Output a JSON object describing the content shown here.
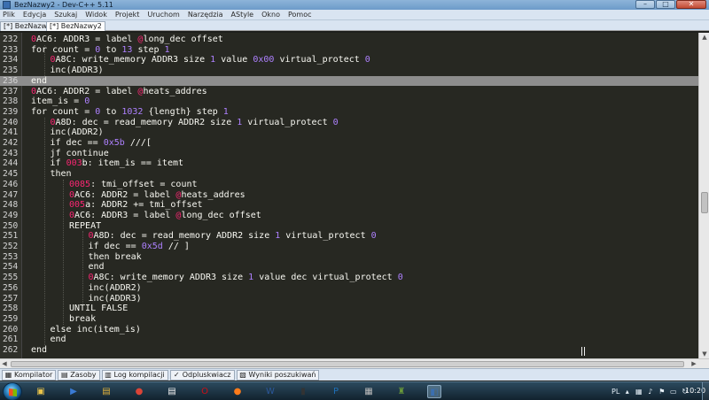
{
  "window": {
    "title": "BezNazwy2 - Dev-C++ 5.11"
  },
  "menu": [
    "Plik",
    "Edycja",
    "Szukaj",
    "Widok",
    "Projekt",
    "Uruchom",
    "Narzędzia",
    "AStyle",
    "Okno",
    "Pomoc"
  ],
  "tabs": [
    "[*] BezNazwy1",
    "[*] BezNazwy2"
  ],
  "active_tab_index": 1,
  "highlighted_line": 236,
  "colors": {
    "label_prefix": "#f92672",
    "number": "#ae81ff",
    "text": "#f8f8f2",
    "background": "#272822",
    "current_line": "#8d8d8d"
  },
  "lines": [
    {
      "n": "232",
      "indent": 1,
      "tokens": [
        [
          "lab",
          "0"
        ],
        [
          "txt",
          "AC6: ADDR3 = label "
        ],
        [
          "lab",
          "@"
        ],
        [
          "txt",
          "long_dec offset"
        ]
      ]
    },
    {
      "n": "233",
      "indent": 1,
      "tokens": [
        [
          "txt",
          "for count = "
        ],
        [
          "num",
          "0"
        ],
        [
          "txt",
          " to "
        ],
        [
          "num",
          "13"
        ],
        [
          "txt",
          " step "
        ],
        [
          "num",
          "1"
        ]
      ]
    },
    {
      "n": "234",
      "indent": 2,
      "tokens": [
        [
          "lab",
          "0"
        ],
        [
          "txt",
          "A8C: write_memory ADDR3 size "
        ],
        [
          "num",
          "1"
        ],
        [
          "txt",
          " value "
        ],
        [
          "num",
          "0x00"
        ],
        [
          "txt",
          " virtual_protect "
        ],
        [
          "num",
          "0"
        ]
      ]
    },
    {
      "n": "235",
      "indent": 2,
      "tokens": [
        [
          "txt",
          "inc(ADDR3)"
        ]
      ]
    },
    {
      "n": "236",
      "indent": 1,
      "tokens": [
        [
          "txt",
          "end"
        ]
      ]
    },
    {
      "n": "237",
      "indent": 1,
      "tokens": [
        [
          "lab",
          "0"
        ],
        [
          "txt",
          "AC6: ADDR2 = label "
        ],
        [
          "lab",
          "@"
        ],
        [
          "txt",
          "heats_addres"
        ]
      ]
    },
    {
      "n": "238",
      "indent": 1,
      "tokens": [
        [
          "txt",
          "item_is = "
        ],
        [
          "num",
          "0"
        ]
      ]
    },
    {
      "n": "239",
      "indent": 1,
      "tokens": [
        [
          "txt",
          "for count = "
        ],
        [
          "num",
          "0"
        ],
        [
          "txt",
          " to "
        ],
        [
          "num",
          "1032"
        ],
        [
          "txt",
          " {length} step "
        ],
        [
          "num",
          "1"
        ]
      ]
    },
    {
      "n": "240",
      "indent": 2,
      "tokens": [
        [
          "lab",
          "0"
        ],
        [
          "txt",
          "A8D: dec = read_memory ADDR2 size "
        ],
        [
          "num",
          "1"
        ],
        [
          "txt",
          " virtual_protect "
        ],
        [
          "num",
          "0"
        ]
      ]
    },
    {
      "n": "241",
      "indent": 2,
      "tokens": [
        [
          "txt",
          "inc(ADDR2)"
        ]
      ]
    },
    {
      "n": "242",
      "indent": 2,
      "tokens": [
        [
          "txt",
          "if dec == "
        ],
        [
          "num",
          "0x5b"
        ],
        [
          "txt",
          " ///["
        ]
      ]
    },
    {
      "n": "243",
      "indent": 2,
      "tokens": [
        [
          "txt",
          "jf continue"
        ]
      ]
    },
    {
      "n": "244",
      "indent": 2,
      "tokens": [
        [
          "txt",
          "if "
        ],
        [
          "lab",
          "003"
        ],
        [
          "txt",
          "b: item_is == itemt"
        ]
      ]
    },
    {
      "n": "245",
      "indent": 2,
      "tokens": [
        [
          "txt",
          "then"
        ]
      ]
    },
    {
      "n": "246",
      "indent": 3,
      "tokens": [
        [
          "lab",
          "0085"
        ],
        [
          "txt",
          ": tmi_offset = count"
        ]
      ]
    },
    {
      "n": "247",
      "indent": 3,
      "tokens": [
        [
          "lab",
          "0"
        ],
        [
          "txt",
          "AC6: ADDR2 = label "
        ],
        [
          "lab",
          "@"
        ],
        [
          "txt",
          "heats_addres"
        ]
      ]
    },
    {
      "n": "248",
      "indent": 3,
      "tokens": [
        [
          "lab",
          "005"
        ],
        [
          "txt",
          "a: ADDR2 += tmi_offset"
        ]
      ]
    },
    {
      "n": "249",
      "indent": 3,
      "tokens": [
        [
          "lab",
          "0"
        ],
        [
          "txt",
          "AC6: ADDR3 = label "
        ],
        [
          "lab",
          "@"
        ],
        [
          "txt",
          "long_dec offset"
        ]
      ]
    },
    {
      "n": "250",
      "indent": 3,
      "tokens": [
        [
          "txt",
          "REPEAT"
        ]
      ]
    },
    {
      "n": "251",
      "indent": 4,
      "tokens": [
        [
          "lab",
          "0"
        ],
        [
          "txt",
          "A8D: dec = read_memory ADDR2 size "
        ],
        [
          "num",
          "1"
        ],
        [
          "txt",
          " virtual_protect "
        ],
        [
          "num",
          "0"
        ]
      ]
    },
    {
      "n": "252",
      "indent": 4,
      "tokens": [
        [
          "txt",
          "if dec == "
        ],
        [
          "num",
          "0x5d"
        ],
        [
          "txt",
          " // ]"
        ]
      ]
    },
    {
      "n": "253",
      "indent": 4,
      "tokens": [
        [
          "txt",
          "then break"
        ]
      ]
    },
    {
      "n": "254",
      "indent": 4,
      "tokens": [
        [
          "txt",
          "end"
        ]
      ]
    },
    {
      "n": "255",
      "indent": 4,
      "tokens": [
        [
          "lab",
          "0"
        ],
        [
          "txt",
          "A8C: write_memory ADDR3 size "
        ],
        [
          "num",
          "1"
        ],
        [
          "txt",
          " value dec virtual_protect "
        ],
        [
          "num",
          "0"
        ]
      ]
    },
    {
      "n": "256",
      "indent": 4,
      "tokens": [
        [
          "txt",
          "inc(ADDR2)"
        ]
      ]
    },
    {
      "n": "257",
      "indent": 4,
      "tokens": [
        [
          "txt",
          "inc(ADDR3)"
        ]
      ]
    },
    {
      "n": "258",
      "indent": 3,
      "tokens": [
        [
          "txt",
          "UNTIL FALSE"
        ]
      ]
    },
    {
      "n": "259",
      "indent": 3,
      "tokens": [
        [
          "txt",
          "break"
        ]
      ]
    },
    {
      "n": "260",
      "indent": 2,
      "tokens": [
        [
          "txt",
          "else inc(item_is)"
        ]
      ]
    },
    {
      "n": "261",
      "indent": 2,
      "tokens": [
        [
          "txt",
          "end"
        ]
      ]
    },
    {
      "n": "262",
      "indent": 1,
      "tokens": [
        [
          "txt",
          "end"
        ]
      ]
    }
  ],
  "bottom_tabs": [
    {
      "label": "Kompilator",
      "icon": "compiler-icon"
    },
    {
      "label": "Zasoby",
      "icon": "resources-icon"
    },
    {
      "label": "Log kompilacji",
      "icon": "compile-log-icon"
    },
    {
      "label": "Odpluskwiacz",
      "icon": "debugger-icon"
    },
    {
      "label": "Wyniki poszukiwań",
      "icon": "search-results-icon"
    }
  ],
  "taskbar": {
    "icons": [
      "explorer-icon",
      "media-player-icon",
      "folder-icon",
      "chrome-icon",
      "notepad-icon",
      "opera-icon",
      "firefox-icon",
      "word-icon",
      "terminal-icon",
      "photoshop-icon",
      "calculator-icon",
      "game-icon",
      "devcpp-icon"
    ],
    "language": "PL",
    "clock": "10:20"
  }
}
